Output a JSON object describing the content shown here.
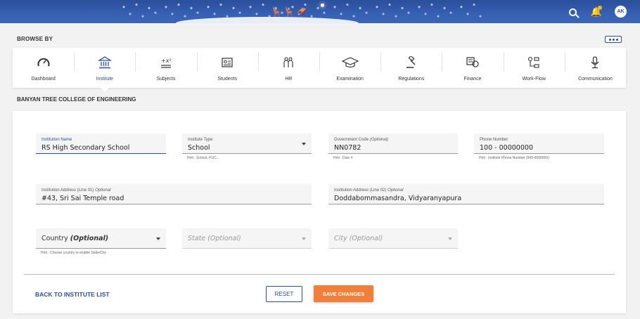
{
  "topbar": {
    "avatar_initials": "AK",
    "icons": [
      "search-icon",
      "notification-bell-icon"
    ],
    "accent": "#2a4f9a"
  },
  "browse": {
    "label": "BROWSE BY",
    "more_icon": "more-dots-icon",
    "items": [
      {
        "label": "Dashboard",
        "icon": "speedometer-icon",
        "active": false
      },
      {
        "label": "Institute",
        "icon": "institution-icon",
        "active": true
      },
      {
        "label": "Subjects",
        "icon": "subjects-icon",
        "active": false
      },
      {
        "label": "Students",
        "icon": "student-card-icon",
        "active": false
      },
      {
        "label": "HR",
        "icon": "people-icon",
        "active": false
      },
      {
        "label": "Examination",
        "icon": "graduation-cap-icon",
        "active": false
      },
      {
        "label": "Regulations",
        "icon": "gavel-icon",
        "active": false
      },
      {
        "label": "Finance",
        "icon": "money-icon",
        "active": false
      },
      {
        "label": "Work-Flow",
        "icon": "workflow-icon",
        "active": false
      },
      {
        "label": "Communication",
        "icon": "microphone-icon",
        "active": false
      }
    ]
  },
  "college": {
    "title": "BANYAN TREE COLLEGE OF ENGINEERING"
  },
  "form": {
    "institution_name": {
      "label": "Institution Name",
      "value": "RS High Secondary School"
    },
    "institute_type": {
      "label": "Institute Type",
      "value": "School",
      "hint": "Hint : School, PUC..."
    },
    "government_code": {
      "label": "Government Code",
      "label_optional": "(Optional)",
      "value": "NN0782",
      "hint": "Hint : Dise #"
    },
    "phone_number": {
      "label": "Phone Number",
      "value": "100 - 00000000",
      "hint": "Hint : Institute Phone Number (000-0000000)"
    },
    "address_line1": {
      "label": "Institution Address (Line 01)",
      "label_optional": "Optional",
      "value": "#43, Sri Sai Temple road"
    },
    "address_line2": {
      "label": "Institution Address (Line 02)",
      "label_optional": "Optional",
      "value": "Doddabommasandra, Vidyaranyapura"
    },
    "country": {
      "label": "Country",
      "label_optional": "(Optional)",
      "hint": "Hint : Choose country to enable State/City"
    },
    "state": {
      "placeholder": "State (Optional)"
    },
    "city": {
      "placeholder": "City (Optional)"
    }
  },
  "actions": {
    "back_label": "BACK TO  INSTITUTE LIST",
    "reset_label": "RESET",
    "save_label": "SAVE CHANGES",
    "save_color": "#f07f3c"
  }
}
